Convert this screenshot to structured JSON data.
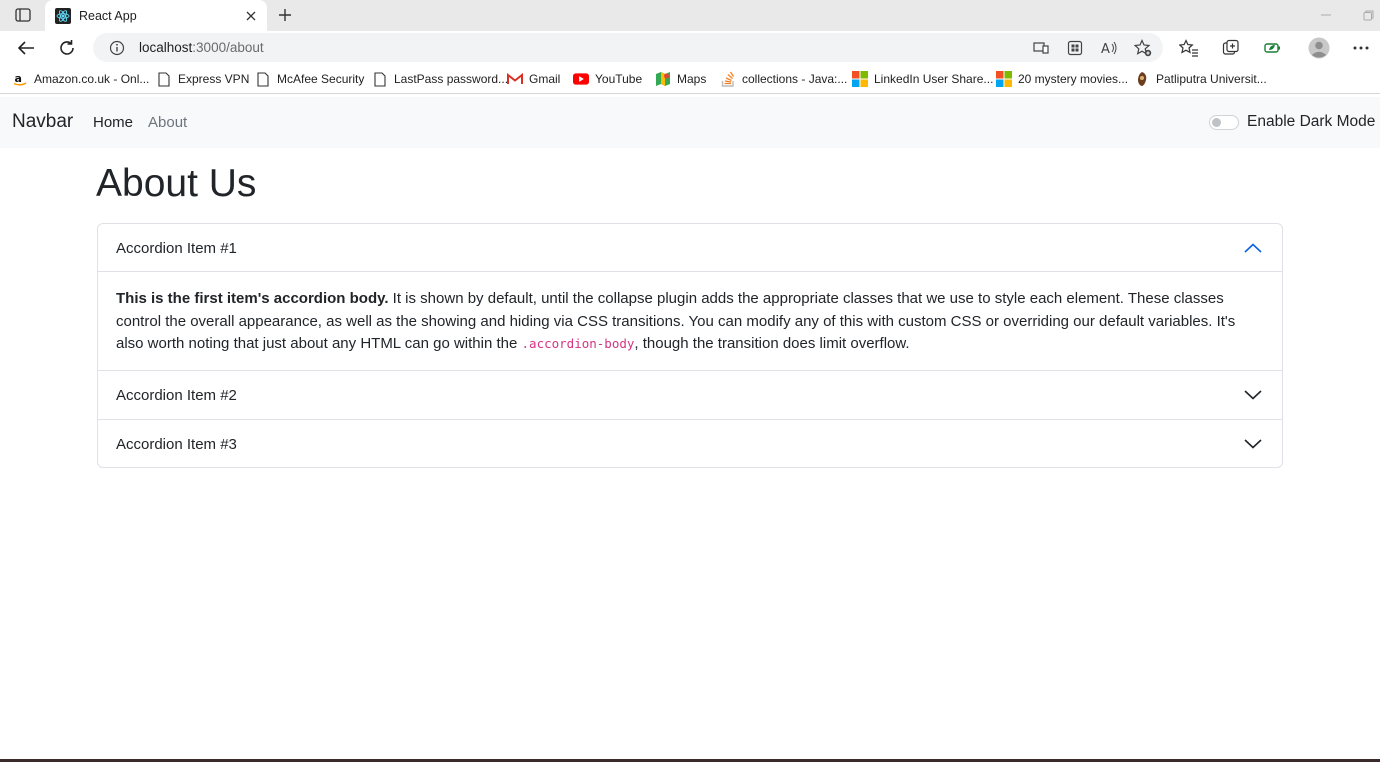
{
  "browser": {
    "tab_title": "React App",
    "address": {
      "host": "localhost",
      "path": ":3000/about"
    },
    "bookmarks": [
      {
        "label": "Amazon.co.uk - Onl...",
        "icon": "amazon-icon"
      },
      {
        "label": "Express VPN",
        "icon": "page-icon"
      },
      {
        "label": "McAfee Security",
        "icon": "page-icon"
      },
      {
        "label": "LastPass password...",
        "icon": "page-icon"
      },
      {
        "label": "Gmail",
        "icon": "gmail-icon"
      },
      {
        "label": "YouTube",
        "icon": "youtube-icon"
      },
      {
        "label": "Maps",
        "icon": "maps-icon"
      },
      {
        "label": "collections - Java:...",
        "icon": "stackoverflow-icon"
      },
      {
        "label": "LinkedIn User Share...",
        "icon": "microsoft-icon"
      },
      {
        "label": "20 mystery movies...",
        "icon": "microsoft-icon"
      },
      {
        "label": "Patliputra Universit...",
        "icon": "university-icon"
      }
    ]
  },
  "navbar": {
    "brand": "Navbar",
    "links": [
      "Home",
      "About"
    ],
    "dark_mode_label": "Enable Dark Mode",
    "dark_mode_on": false
  },
  "page": {
    "title": "About Us",
    "accordion": [
      {
        "title": "Accordion Item #1",
        "expanded": true,
        "body_lead": "This is the first item's accordion body.",
        "body_text_1": " It is shown by default, until the collapse plugin adds the appropriate classes that we use to style each element. These classes control the overall appearance, as well as the showing and hiding via CSS transitions. You can modify any of this with custom CSS or overriding our default variables. It's also worth noting that just about any HTML can go within the ",
        "body_code": ".accordion-body",
        "body_text_2": ", though the transition does limit overflow."
      },
      {
        "title": "Accordion Item #2",
        "expanded": false
      },
      {
        "title": "Accordion Item #3",
        "expanded": false
      }
    ]
  },
  "colors": {
    "navbar_bg": "#f8f9fa",
    "accent_chevron": "#0c63e4",
    "code": "#d63384",
    "nav_muted": "#6c757d"
  }
}
